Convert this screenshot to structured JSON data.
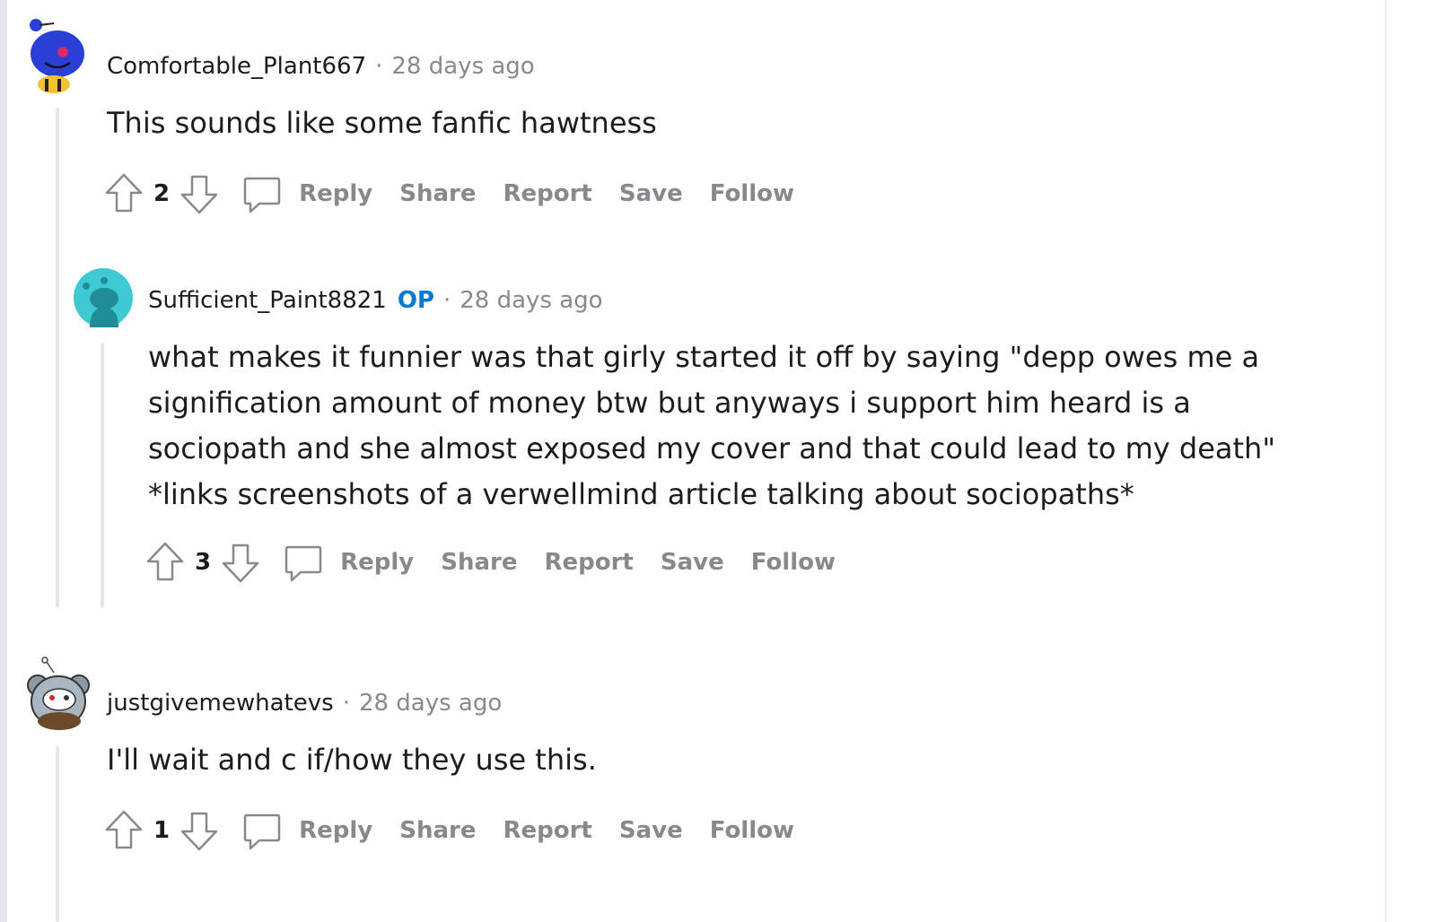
{
  "comments": [
    {
      "username": "Comfortable_Plant667",
      "op_label": "",
      "separator": "·",
      "timestamp": "28 days ago",
      "body": [
        "This sounds like some fanfic hawtness"
      ],
      "score": "2",
      "actions": {
        "reply": "Reply",
        "share": "Share",
        "report": "Report",
        "save": "Save",
        "follow": "Follow"
      },
      "avatar": "snoo-blue-bee-icon"
    },
    {
      "username": "Sufficient_Paint8821",
      "op_label": "OP",
      "separator": "·",
      "timestamp": "28 days ago",
      "body": [
        "what makes it funnier was that girly started it off by saying \"depp owes me a",
        "signification amount of money btw but anyways i support him heard is a",
        "sociopath and she almost exposed my cover and that could lead to my death\"",
        "*links screenshots of a verwellmind article talking about sociopaths*"
      ],
      "score": "3",
      "actions": {
        "reply": "Reply",
        "share": "Share",
        "report": "Report",
        "save": "Save",
        "follow": "Follow"
      },
      "avatar": "default-teal-snoo-icon"
    },
    {
      "username": "justgivemewhatevs",
      "op_label": "",
      "separator": "·",
      "timestamp": "28 days ago",
      "body": [
        "I'll wait and c if/how they use this."
      ],
      "score": "1",
      "actions": {
        "reply": "Reply",
        "share": "Share",
        "report": "Report",
        "save": "Save",
        "follow": "Follow"
      },
      "avatar": "snoo-mouse-costume-icon"
    }
  ],
  "colors": {
    "text": "#1c1c1c",
    "meta": "#878a8c",
    "op": "#0079d3",
    "thread_line": "#e4e6e9",
    "avatar_blue": "#2a3fd6",
    "avatar_teal": "#3ec9d3"
  }
}
